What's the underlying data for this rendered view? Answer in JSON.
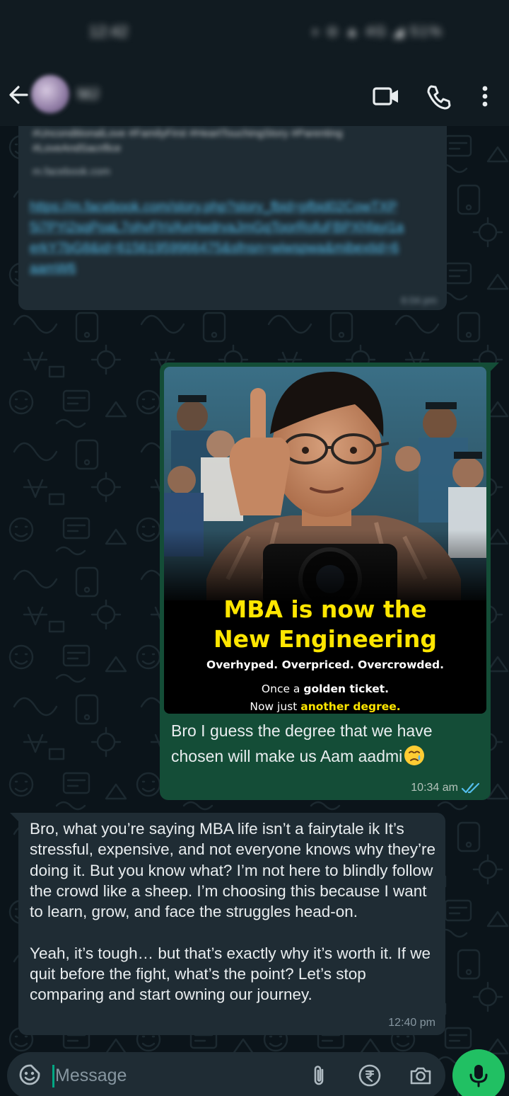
{
  "status_bar": {
    "time": "12:42",
    "icons": "◗ ⊝ ▲ 4G ◢ 51%"
  },
  "header": {
    "contact_name": "MJ",
    "icons": [
      "back-arrow-icon",
      "video-call-icon",
      "phone-icon",
      "more-vert-icon"
    ]
  },
  "messages": [
    {
      "id": "link",
      "direction": "incoming",
      "hashtags": "#UnconditionalLove #FamilyFirst #HeartTouchingStory #Parenting #LoveAndSacrifice",
      "domain": "m.facebook.com",
      "url": "https://m.facebook.com/story.php?story_fbid=pfbid02CowTXP5i7PYi2sqPoaL7ohvFhVAxHwdrvaJmGqToorRofuFBPXhfayi1aerkY7bG8&id=61561959966475&sfnsn=wiwspwa&mibextid=6aamW6",
      "time": "6:04 pm"
    },
    {
      "id": "image",
      "direction": "outgoing",
      "image": {
        "headline_line1": "MBA is now the",
        "headline_line2": "New Engineering",
        "subline": "Overhyped. Overpriced. Overcrowded.",
        "line3_prefix": "Once a ",
        "line3_bold": "golden ticket.",
        "line4_prefix": "Now just ",
        "line4_highlight": "another degree."
      },
      "caption": "Bro I guess the degree that we have chosen will make us Aam aadmi",
      "emoji": "crying-face-emoji",
      "time": "10:34 am",
      "status": "read"
    },
    {
      "id": "reply",
      "direction": "incoming",
      "text": "Bro, what you’re saying  MBA life isn’t a fairytale ik It’s stressful, expensive, and not everyone knows why they’re doing it. But you know what? I’m not here to blindly follow the crowd like a sheep. I’m choosing this because I want to learn, grow, and face the struggles head-on.\n\nYeah, it’s tough… but that’s exactly why it’s worth it. If we quit before the fight, what’s the point? Let’s stop comparing and start owning our journey.",
      "time": "12:40 pm"
    }
  ],
  "input": {
    "placeholder": "Message",
    "icons": [
      "emoji-sticker-icon",
      "attach-icon",
      "rupee-payment-icon",
      "camera-icon",
      "mic-icon"
    ]
  },
  "colors": {
    "background": "#0b141a",
    "header": "#111b21",
    "incoming_bubble": "#1f2c34",
    "outgoing_bubble": "#144d37",
    "accent_green": "#21c063",
    "read_ticks": "#53bdeb",
    "poster_yellow": "#ffe600"
  }
}
